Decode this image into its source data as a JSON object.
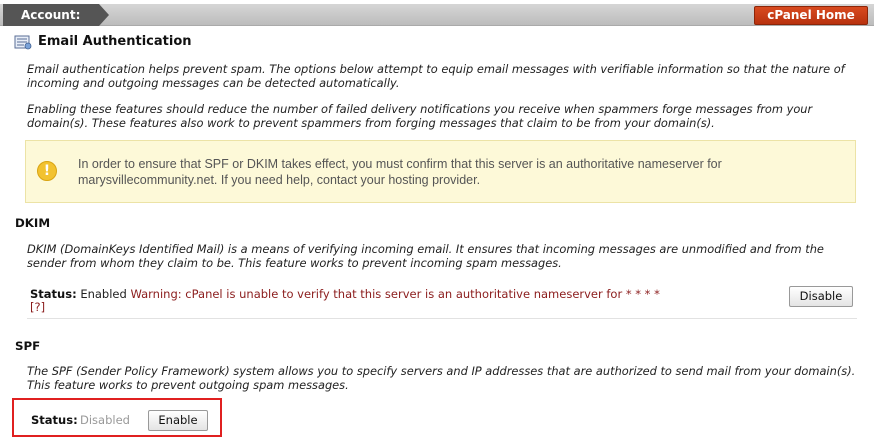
{
  "topbar": {
    "breadcrumb": "Account:",
    "home_button": "cPanel Home"
  },
  "page": {
    "icon": "email-auth-icon",
    "title": "Email Authentication",
    "intro_1": "Email authentication helps prevent spam. The options below attempt to equip email messages with verifiable information so that the nature of incoming and outgoing messages can be detected automatically.",
    "intro_2": "Enabling these features should reduce the number of failed delivery notifications you receive when spammers forge messages from your domain(s). These features also work to prevent spammers from forging messages that claim to be from your domain(s)."
  },
  "warning": {
    "icon": "exclamation-icon",
    "text": "In order to ensure that SPF or DKIM takes effect, you must confirm that this server is an authoritative nameserver for marysvillecommunity.net. If you need help, contact your hosting provider."
  },
  "dkim": {
    "title": "DKIM",
    "description": "DKIM (DomainKeys Identified Mail) is a means of verifying incoming email. It ensures that incoming messages are unmodified and from the sender from whom they claim to be. This feature works to prevent incoming spam messages.",
    "status_label": "Status:",
    "status_value": "Enabled",
    "warning": "Warning: cPanel is unable to verify that this server is an authoritative nameserver for * * * *",
    "help_link": "[?]",
    "button": "Disable"
  },
  "spf": {
    "title": "SPF",
    "description": "The SPF (Sender Policy Framework) system allows you to specify servers and IP addresses that are authorized to send mail from your domain(s). This feature works to prevent outgoing spam messages.",
    "status_label": "Status:",
    "status_value": "Disabled",
    "button": "Enable"
  },
  "colors": {
    "accent": "#c43c14",
    "warning_bg": "#fdf9d8",
    "warning_text": "#8b1c1c",
    "highlight_box": "#e02020"
  }
}
